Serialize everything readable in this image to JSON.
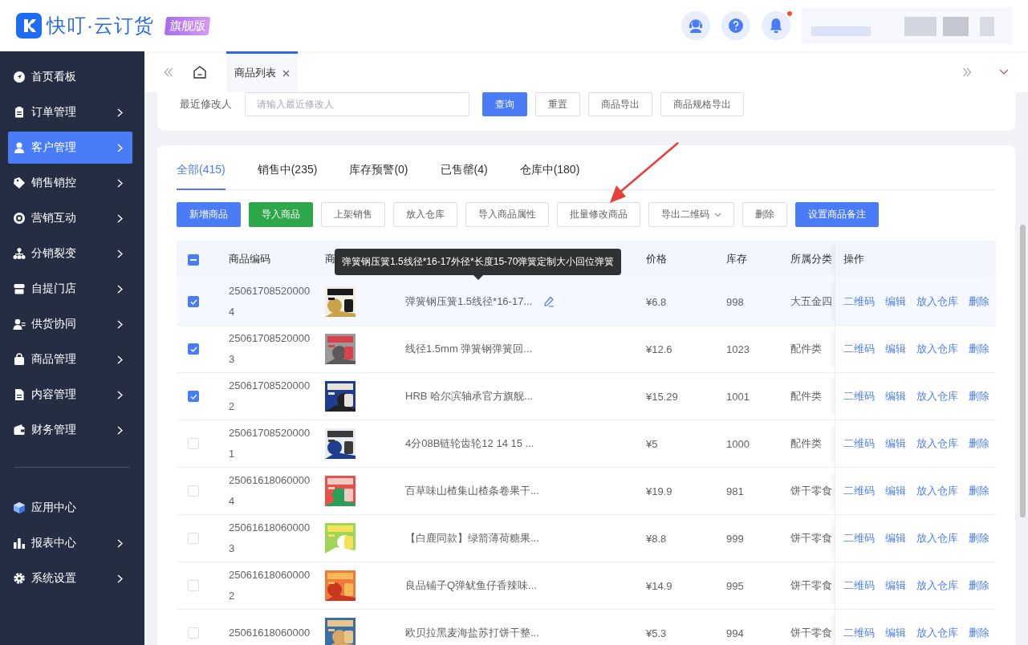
{
  "app": {
    "logo_text": "快叮·云订货",
    "edition_badge": "旗舰版",
    "notification_unread": true
  },
  "sidebar": {
    "items": [
      {
        "label": "首页看板",
        "selected": false,
        "has_children": false
      },
      {
        "label": "订单管理",
        "selected": false,
        "has_children": true
      },
      {
        "label": "客户管理",
        "selected": true,
        "has_children": true
      },
      {
        "label": "销售销控",
        "selected": false,
        "has_children": true
      },
      {
        "label": "营销互动",
        "selected": false,
        "has_children": true
      },
      {
        "label": "分销裂变",
        "selected": false,
        "has_children": true
      },
      {
        "label": "自提门店",
        "selected": false,
        "has_children": true
      },
      {
        "label": "供货协同",
        "selected": false,
        "has_children": true
      },
      {
        "label": "商品管理",
        "selected": false,
        "has_children": true
      },
      {
        "label": "内容管理",
        "selected": false,
        "has_children": true
      },
      {
        "label": "财务管理",
        "selected": false,
        "has_children": true
      }
    ],
    "bottom_items": [
      {
        "label": "应用中心",
        "selected": false,
        "has_children": false
      },
      {
        "label": "报表中心",
        "selected": false,
        "has_children": true
      },
      {
        "label": "系统设置",
        "selected": false,
        "has_children": true
      }
    ]
  },
  "page_tabs": [
    {
      "label": "商品列表",
      "selected": true
    }
  ],
  "filter": {
    "label": "最近修改人",
    "placeholder": "请输入最近修改人",
    "buttons": [
      {
        "label": "查询",
        "kind": "primary"
      },
      {
        "label": "重置",
        "kind": "default"
      },
      {
        "label": "商品导出",
        "kind": "default"
      },
      {
        "label": "商品规格导出",
        "kind": "default"
      }
    ]
  },
  "status_tabs": [
    {
      "label": "全部(415)",
      "selected": true
    },
    {
      "label": "销售中(235)",
      "selected": false
    },
    {
      "label": "库存预警(0)",
      "selected": false
    },
    {
      "label": "已售罄(4)",
      "selected": false
    },
    {
      "label": "仓库中(180)",
      "selected": false
    }
  ],
  "actions": [
    {
      "label": "新增商品",
      "kind": "primary"
    },
    {
      "label": "导入商品",
      "kind": "success"
    },
    {
      "label": "上架销售",
      "kind": "default"
    },
    {
      "label": "放入仓库",
      "kind": "default"
    },
    {
      "label": "导入商品属性",
      "kind": "default"
    },
    {
      "label": "批量修改商品",
      "kind": "default"
    },
    {
      "label": "导出二维码",
      "kind": "dropdown"
    },
    {
      "label": "删除",
      "kind": "default"
    },
    {
      "label": "设置商品备注",
      "kind": "primary"
    }
  ],
  "table": {
    "header_checkbox_indeterminate": true,
    "columns": [
      "商品编码",
      "商",
      "价格",
      "库存",
      "所属分类",
      "操作"
    ],
    "tooltip": "弹簧钢压簧1.5线径*16-17外径*长度15-70弹簧定制大小回位弹簧",
    "rows": [
      {
        "checked": true,
        "hovered": true,
        "code": "250617085200004",
        "image": {
          "kind": "picture"
        },
        "name": "弹簧钢压簧1.5线径*16-17...",
        "price": "¥6.8",
        "stock": "998",
        "category": "大五金四",
        "actions": [
          "二维码",
          "编辑",
          "放入仓库",
          "删除"
        ]
      },
      {
        "checked": true,
        "hovered": false,
        "code": "250617085200003",
        "image": {
          "kind": "picture"
        },
        "name": "线径1.5mm 弹簧钢弹簧回...",
        "price": "¥12.6",
        "stock": "1023",
        "category": "配件类",
        "actions": [
          "二维码",
          "编辑",
          "放入仓库",
          "删除"
        ]
      },
      {
        "checked": true,
        "hovered": false,
        "code": "250617085200002",
        "image": {
          "kind": "picture"
        },
        "name": "HRB 哈尔滨轴承官方旗舰...",
        "price": "¥15.29",
        "stock": "1001",
        "category": "配件类",
        "actions": [
          "二维码",
          "编辑",
          "放入仓库",
          "删除"
        ]
      },
      {
        "checked": false,
        "hovered": false,
        "code": "250617085200001",
        "image": {
          "kind": "picture"
        },
        "name": "4分08B链轮齿轮12 14 15 ...",
        "price": "¥5",
        "stock": "1000",
        "category": "配件类",
        "actions": [
          "二维码",
          "编辑",
          "放入仓库",
          "删除"
        ]
      },
      {
        "checked": false,
        "hovered": false,
        "code": "250616180600004",
        "image": {
          "kind": "picture"
        },
        "name": "百草味山楂集山楂条卷果干...",
        "price": "¥19.9",
        "stock": "981",
        "category": "饼干零食",
        "actions": [
          "二维码",
          "编辑",
          "放入仓库",
          "删除"
        ]
      },
      {
        "checked": false,
        "hovered": false,
        "code": "250616180600003",
        "image": {
          "kind": "picture"
        },
        "name": "【白鹿同款】绿箭薄荷糖果...",
        "price": "¥8.8",
        "stock": "999",
        "category": "饼干零食",
        "actions": [
          "二维码",
          "编辑",
          "放入仓库",
          "删除"
        ]
      },
      {
        "checked": false,
        "hovered": false,
        "code": "250616180600002",
        "image": {
          "kind": "picture"
        },
        "name": "良品铺子Q弹鱿鱼仔香辣味...",
        "price": "¥14.9",
        "stock": "995",
        "category": "饼干零食",
        "actions": [
          "二维码",
          "编辑",
          "放入仓库",
          "删除"
        ]
      },
      {
        "checked": false,
        "hovered": false,
        "code": "25061618060000",
        "image": {
          "kind": "picture"
        },
        "name": "欧贝拉黑麦海盐苏打饼干整...",
        "price": "¥5.3",
        "stock": "994",
        "category": "饼干零食",
        "actions": [
          "二维码",
          "编辑",
          "放入仓库",
          "删除"
        ]
      }
    ]
  }
}
